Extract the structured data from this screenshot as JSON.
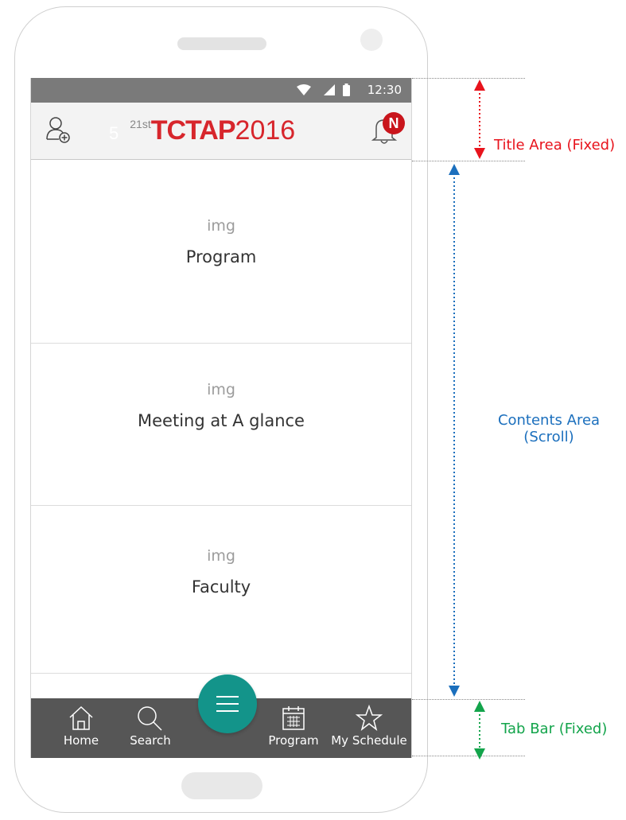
{
  "statusbar": {
    "time": "12:30"
  },
  "header": {
    "logo_lead": "5",
    "logo_ordinal": "21st",
    "logo_brand": "TCTAP",
    "logo_year": "2016",
    "notification_badge": "N"
  },
  "menu": [
    {
      "placeholder": "img",
      "label": "Program"
    },
    {
      "placeholder": "img",
      "label": "Meeting at A glance"
    },
    {
      "placeholder": "img",
      "label": "Faculty"
    }
  ],
  "tabs": [
    {
      "label": "Home",
      "icon": "home-icon"
    },
    {
      "label": "Search",
      "icon": "search-icon"
    },
    {
      "label": "Program",
      "icon": "calendar-icon"
    },
    {
      "label": "My Schedule",
      "icon": "star-icon"
    }
  ],
  "annotations": {
    "title_area": "Title Area (Fixed)",
    "contents_area_line1": "Contents Area",
    "contents_area_line2": "(Scroll)",
    "tab_bar": "Tab Bar (Fixed)"
  },
  "colors": {
    "brand_red": "#d7262c",
    "fab_teal": "#13948a",
    "tabbar": "#565656",
    "statusbar": "#7a7a7a",
    "title_note": "#e8131c",
    "contents_note": "#1b6fbd",
    "tab_note": "#13a44b"
  }
}
